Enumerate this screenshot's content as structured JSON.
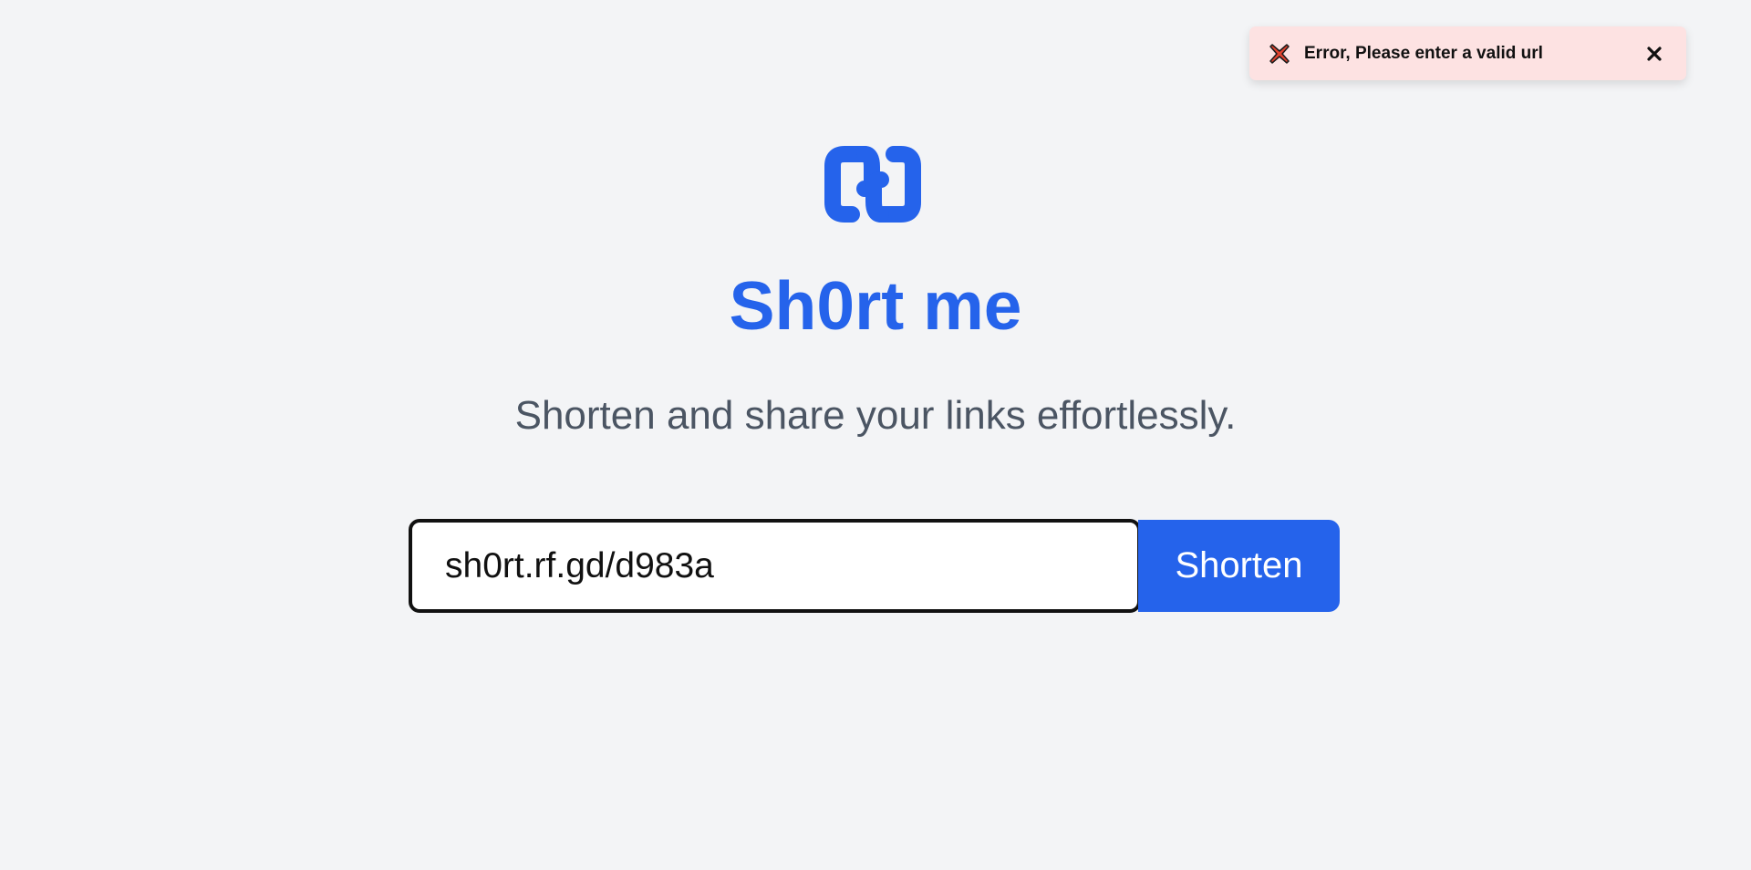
{
  "toast": {
    "icon": "error-x-icon",
    "message": "Error, Please enter a valid url",
    "close_icon": "close-icon",
    "background_color": "#fde2e2"
  },
  "app": {
    "logo_icon": "chain-link-logo-icon",
    "title": "Sh0rt me",
    "subtitle": "Shorten and share your links effortlessly.",
    "accent_color": "#2563eb"
  },
  "form": {
    "url_value": "sh0rt.rf.gd/d983a",
    "submit_label": "Shorten"
  }
}
